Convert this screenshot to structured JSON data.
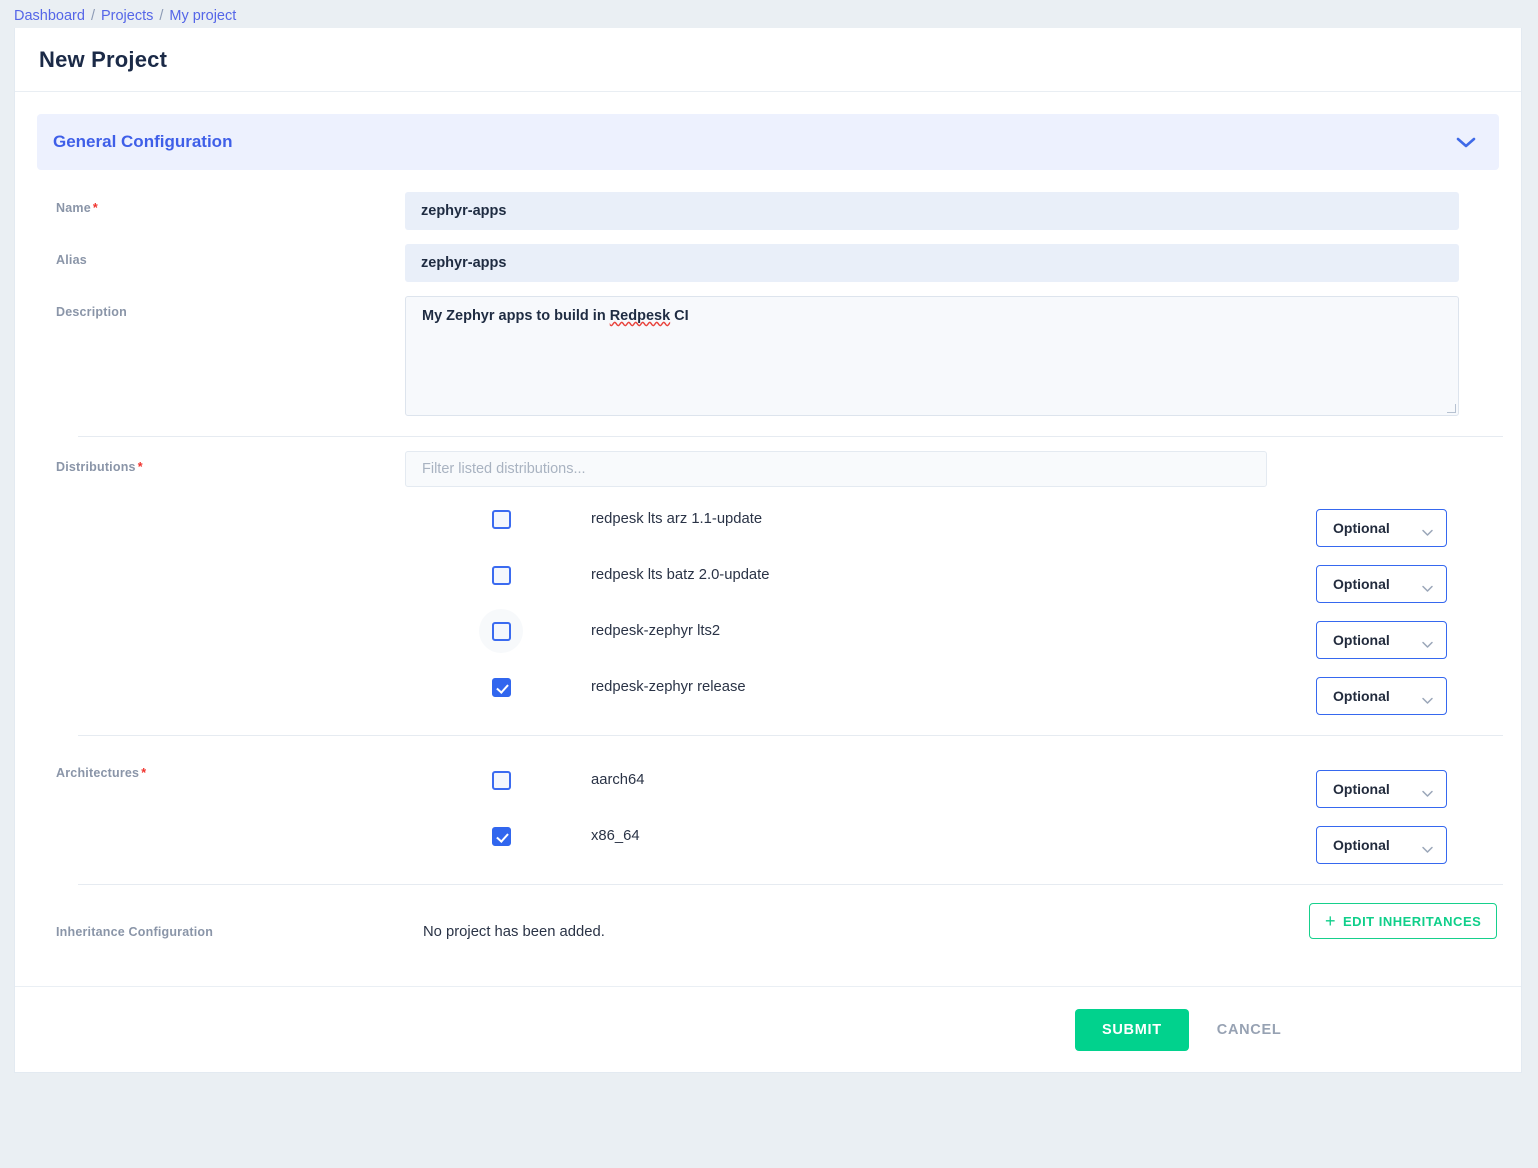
{
  "breadcrumb": {
    "items": [
      {
        "label": "Dashboard"
      },
      {
        "label": "Projects"
      },
      {
        "label": "My project"
      }
    ],
    "separator": "/"
  },
  "header": {
    "title": "New Project"
  },
  "section": {
    "title": "General Configuration",
    "collapse_icon": "chevron-down-icon"
  },
  "fields": {
    "name": {
      "label": "Name",
      "required": "*",
      "value": "zephyr-apps"
    },
    "alias": {
      "label": "Alias",
      "required": "",
      "value": "zephyr-apps"
    },
    "description": {
      "label": "Description",
      "value_prefix": "My Zephyr apps to build in ",
      "value_misspelled": "Redpesk",
      "value_suffix": " CI"
    }
  },
  "distributions": {
    "label": "Distributions",
    "required": "*",
    "filter_placeholder": "Filter listed distributions...",
    "filter_value": "",
    "items": [
      {
        "name": "redpesk lts arz 1.1-update",
        "checked": false,
        "mode": "Optional"
      },
      {
        "name": "redpesk lts batz 2.0-update",
        "checked": false,
        "mode": "Optional"
      },
      {
        "name": "redpesk-zephyr lts2",
        "checked": false,
        "mode": "Optional"
      },
      {
        "name": "redpesk-zephyr release",
        "checked": true,
        "mode": "Optional"
      }
    ]
  },
  "architectures": {
    "label": "Architectures",
    "required": "*",
    "items": [
      {
        "name": "aarch64",
        "checked": false,
        "mode": "Optional"
      },
      {
        "name": "x86_64",
        "checked": true,
        "mode": "Optional"
      }
    ]
  },
  "inheritance": {
    "label": "Inheritance Configuration",
    "empty_text": "No project has been added.",
    "button_label": "EDIT INHERITANCES",
    "button_icon": "plus-icon"
  },
  "footer": {
    "submit_label": "SUBMIT",
    "cancel_label": "CANCEL"
  },
  "colors": {
    "accent_blue": "#3f5fe8",
    "checkbox_blue": "#3166ee",
    "green": "#01d28d",
    "required_red": "#f0322c",
    "page_bg": "#eaeff3"
  }
}
